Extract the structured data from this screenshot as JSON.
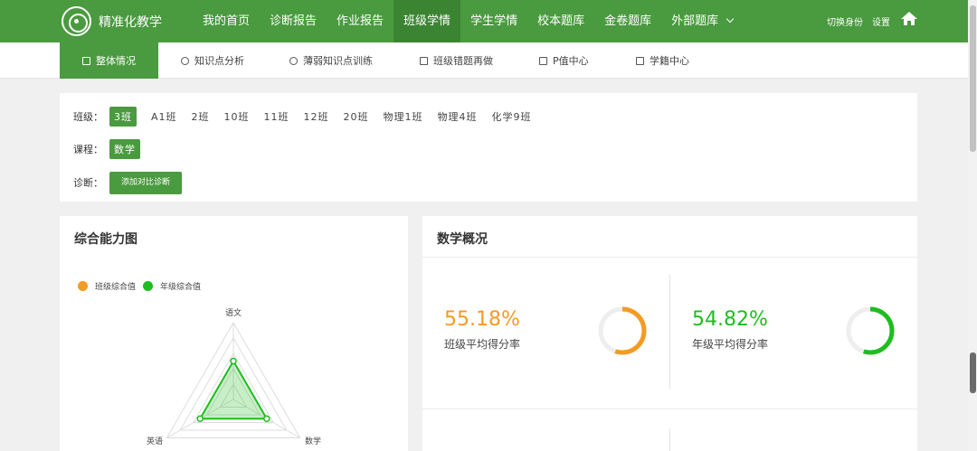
{
  "header": {
    "logo_text": "精准化教学",
    "nav": [
      {
        "label": "我的首页"
      },
      {
        "label": "诊断报告"
      },
      {
        "label": "作业报告"
      },
      {
        "label": "班级学情",
        "active": true
      },
      {
        "label": "学生学情"
      },
      {
        "label": "校本题库"
      },
      {
        "label": "金卷题库"
      },
      {
        "label": "外部题库"
      }
    ],
    "switch_identity": "切换身份",
    "settings": "设置"
  },
  "subnav": [
    {
      "label": "整体情况",
      "active": true
    },
    {
      "label": "知识点分析"
    },
    {
      "label": "薄弱知识点训练"
    },
    {
      "label": "班级错题再做"
    },
    {
      "label": "P值中心"
    },
    {
      "label": "学籍中心"
    }
  ],
  "filters": {
    "class_label": "班级：",
    "classes": [
      "3班",
      "A1班",
      "2班",
      "10班",
      "11班",
      "12班",
      "20班",
      "物理1班",
      "物理4班",
      "化学9班"
    ],
    "selected_class": "3班",
    "course_label": "课程：",
    "course": "数学",
    "diagnosis_label": "诊断：",
    "add_compare_button": "添加对比诊断"
  },
  "ability_card": {
    "title": "综合能力图",
    "legend": [
      "班级综合值",
      "年级综合值"
    ],
    "axes": [
      "语文",
      "数学",
      "英语"
    ]
  },
  "overview_card": {
    "title": "数学概况",
    "class_avg": {
      "value": "55.18%",
      "fraction": 0.5518,
      "label": "班级平均得分率"
    },
    "grade_avg": {
      "value": "54.82%",
      "fraction": 0.5482,
      "label": "年级平均得分率"
    }
  },
  "colors": {
    "primary": "#4a9a3f",
    "primary_dark": "#3b8532",
    "class_color": "#f59a23",
    "grade_color": "#1fbd1f"
  },
  "chart_data": {
    "type": "radar",
    "axes": [
      "语文",
      "数学",
      "英语"
    ],
    "series": [
      {
        "name": "班级综合值",
        "values": [
          null,
          null,
          null
        ]
      },
      {
        "name": "年级综合值",
        "values": [
          0.5,
          0.5,
          0.5
        ]
      }
    ]
  }
}
